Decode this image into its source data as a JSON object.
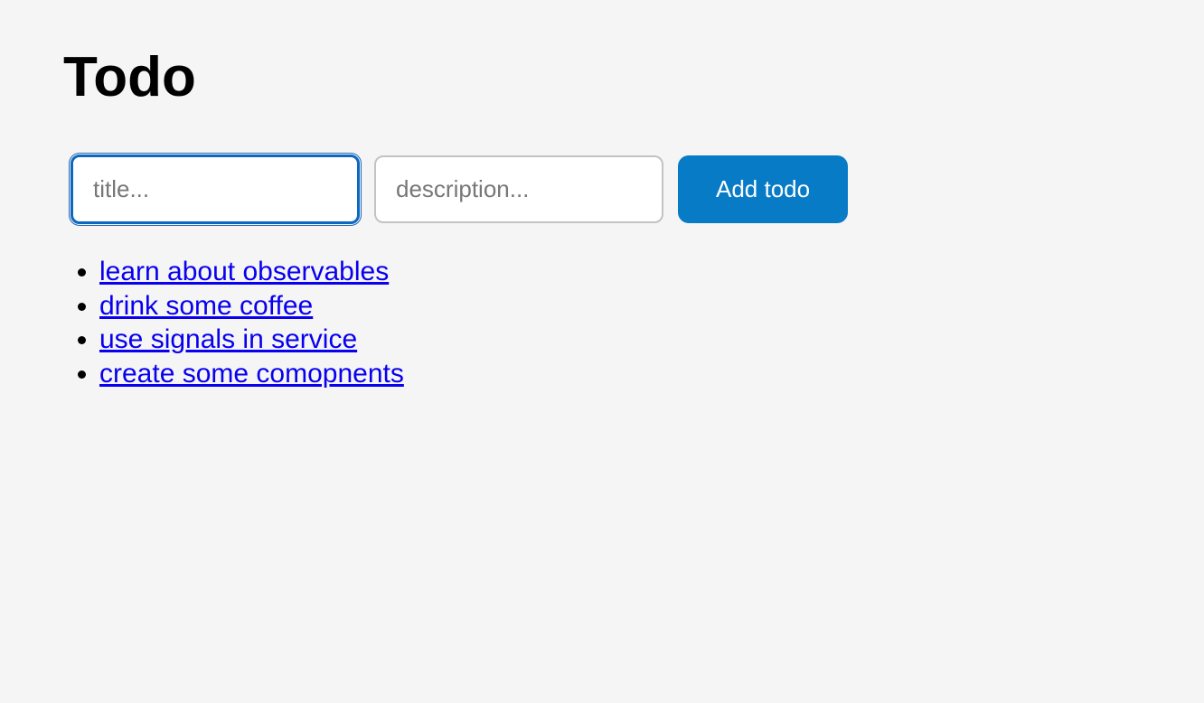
{
  "header": {
    "title": "Todo"
  },
  "form": {
    "title_placeholder": "title...",
    "title_value": "",
    "description_placeholder": "description...",
    "description_value": "",
    "add_button_label": "Add todo"
  },
  "todos": [
    {
      "label": "learn about observables"
    },
    {
      "label": "drink some coffee"
    },
    {
      "label": "use signals in service"
    },
    {
      "label": "create some comopnents"
    }
  ],
  "colors": {
    "background": "#f5f5f5",
    "accent": "#087bc7",
    "input_focus_border": "#0b68c0",
    "input_border": "#c3c3c3",
    "link": "#0800ee"
  }
}
